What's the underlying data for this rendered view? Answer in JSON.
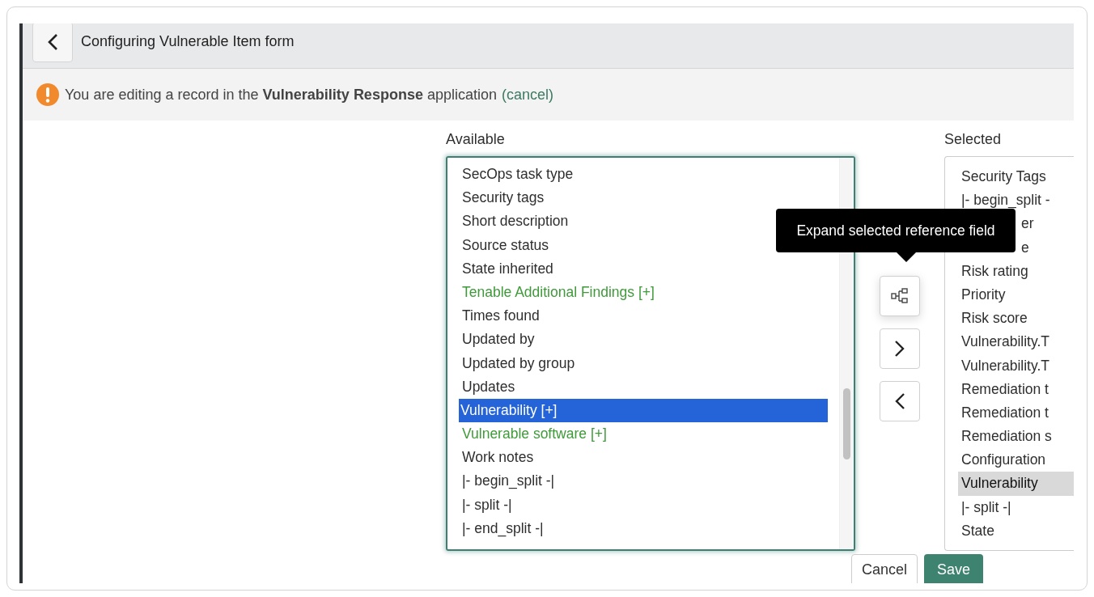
{
  "header": {
    "title": "Configuring Vulnerable Item form"
  },
  "notice": {
    "text": "You are editing a record in the **Vulnerability Response** application",
    "link": "(cancel)"
  },
  "available": {
    "label": "Available",
    "items": [
      {
        "text": "SecOps task type",
        "kind": "field",
        "selected": false
      },
      {
        "text": "Security tags",
        "kind": "field",
        "selected": false
      },
      {
        "text": "Short description",
        "kind": "field",
        "selected": false
      },
      {
        "text": "Source status",
        "kind": "field",
        "selected": false
      },
      {
        "text": "State inherited",
        "kind": "field",
        "selected": false
      },
      {
        "text": "Tenable Additional Findings [+]",
        "kind": "reference",
        "selected": false
      },
      {
        "text": "Times found",
        "kind": "field",
        "selected": false
      },
      {
        "text": "Updated by",
        "kind": "field",
        "selected": false
      },
      {
        "text": "Updated by group",
        "kind": "field",
        "selected": false
      },
      {
        "text": "Updates",
        "kind": "field",
        "selected": false
      },
      {
        "text": "Vulnerability [+]",
        "kind": "reference",
        "selected": true
      },
      {
        "text": "Vulnerable software [+]",
        "kind": "reference",
        "selected": false
      },
      {
        "text": "Work notes",
        "kind": "field",
        "selected": false
      },
      {
        "text": "|- begin_split -|",
        "kind": "field",
        "selected": false
      },
      {
        "text": "|- split -|",
        "kind": "field",
        "selected": false
      },
      {
        "text": "|- end_split -|",
        "kind": "field",
        "selected": false
      }
    ]
  },
  "tooltip": {
    "text": "Expand selected reference field"
  },
  "selected": {
    "label": "Selected",
    "items": [
      {
        "text": "Security Tags",
        "selected": false,
        "covered": false
      },
      {
        "text": "|- begin_split -",
        "selected": false,
        "covered": false
      },
      {
        "text": "er",
        "selected": false,
        "covered": true
      },
      {
        "text": "e",
        "selected": false,
        "covered": true
      },
      {
        "text": "Risk rating",
        "selected": false,
        "covered": false
      },
      {
        "text": "Priority",
        "selected": false,
        "covered": false
      },
      {
        "text": "Risk score",
        "selected": false,
        "covered": false
      },
      {
        "text": "Vulnerability.T",
        "selected": false,
        "covered": false
      },
      {
        "text": "Vulnerability.T",
        "selected": false,
        "covered": false
      },
      {
        "text": "Remediation t",
        "selected": false,
        "covered": false
      },
      {
        "text": "Remediation t",
        "selected": false,
        "covered": false
      },
      {
        "text": "Remediation s",
        "selected": false,
        "covered": false
      },
      {
        "text": "Configuration",
        "selected": false,
        "covered": false
      },
      {
        "text": "Vulnerability",
        "selected": true,
        "covered": false
      },
      {
        "text": "|- split -|",
        "selected": false,
        "covered": false
      },
      {
        "text": "State",
        "selected": false,
        "covered": false
      }
    ]
  },
  "buttons": [
    "Cancel",
    "Save"
  ]
}
